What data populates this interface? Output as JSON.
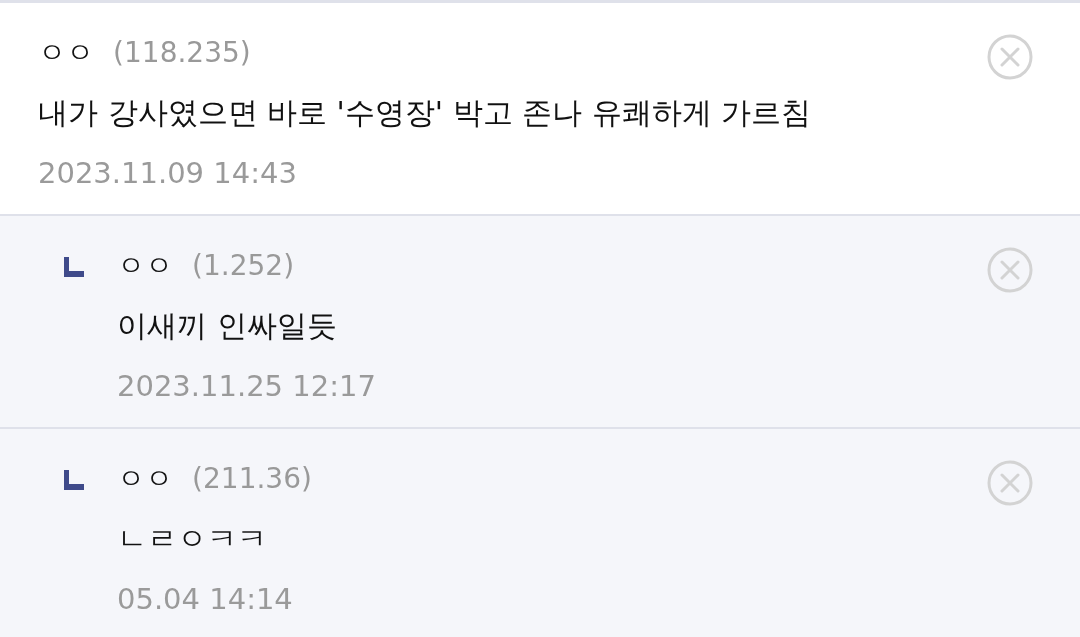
{
  "comments": [
    {
      "kind": "comment",
      "author": "ㅇㅇ",
      "ip": "(118.235)",
      "text": "내가 강사였으면 바로 '수영장' 박고 존나 유쾌하게 가르침",
      "date": "2023.11.09 14:43"
    },
    {
      "kind": "reply",
      "author": "ㅇㅇ",
      "ip": "(1.252)",
      "text": "이새끼 인싸일듯",
      "date": "2023.11.25 12:17"
    },
    {
      "kind": "reply",
      "author": "ㅇㅇ",
      "ip": "(211.36)",
      "text": "ㄴㄹㅇㅋㅋ",
      "date": "05.04 14:14"
    }
  ]
}
